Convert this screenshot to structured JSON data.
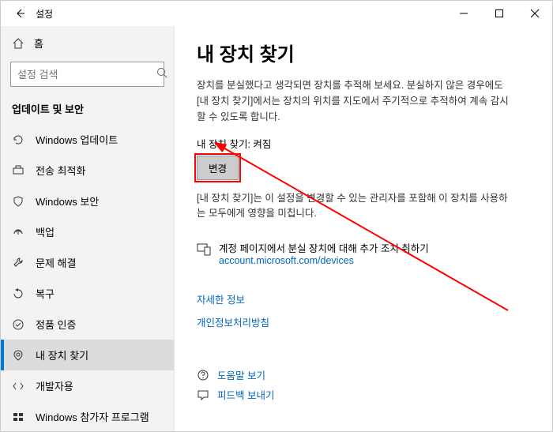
{
  "titlebar": {
    "title": "설정"
  },
  "home": {
    "label": "홈"
  },
  "search": {
    "placeholder": "설정 검색"
  },
  "section": {
    "label": "업데이트 및 보안"
  },
  "nav": {
    "items": [
      {
        "label": "Windows 업데이트"
      },
      {
        "label": "전송 최적화"
      },
      {
        "label": "Windows 보안"
      },
      {
        "label": "백업"
      },
      {
        "label": "문제 해결"
      },
      {
        "label": "복구"
      },
      {
        "label": "정품 인증"
      },
      {
        "label": "내 장치 찾기"
      },
      {
        "label": "개발자용"
      },
      {
        "label": "Windows 참가자 프로그램"
      }
    ]
  },
  "page": {
    "title": "내 장치 찾기",
    "desc": "장치를 분실했다고 생각되면 장치를 추적해 보세요. 분실하지 않은 경우에도 [내 장치 찾기]에서는 장치의 위치를 지도에서 주기적으로 추적하여 계속 감시할 수 있도록 합니다.",
    "status": "내 장치 찾기: 켜짐",
    "change": "변경",
    "note": "[내 장치 찾기]는 이 설정을 변경할 수 있는 관리자를 포함해 이 장치를 사용하는 모두에게 영향을 미칩니다.",
    "account_text": "계정 페이지에서 분실 장치에 대해 추가 조치 취하기",
    "account_link": "account.microsoft.com/devices",
    "moreinfo": "자세한 정보",
    "privacy": "개인정보처리방침",
    "help": "도움말 보기",
    "feedback": "피드백 보내기"
  }
}
